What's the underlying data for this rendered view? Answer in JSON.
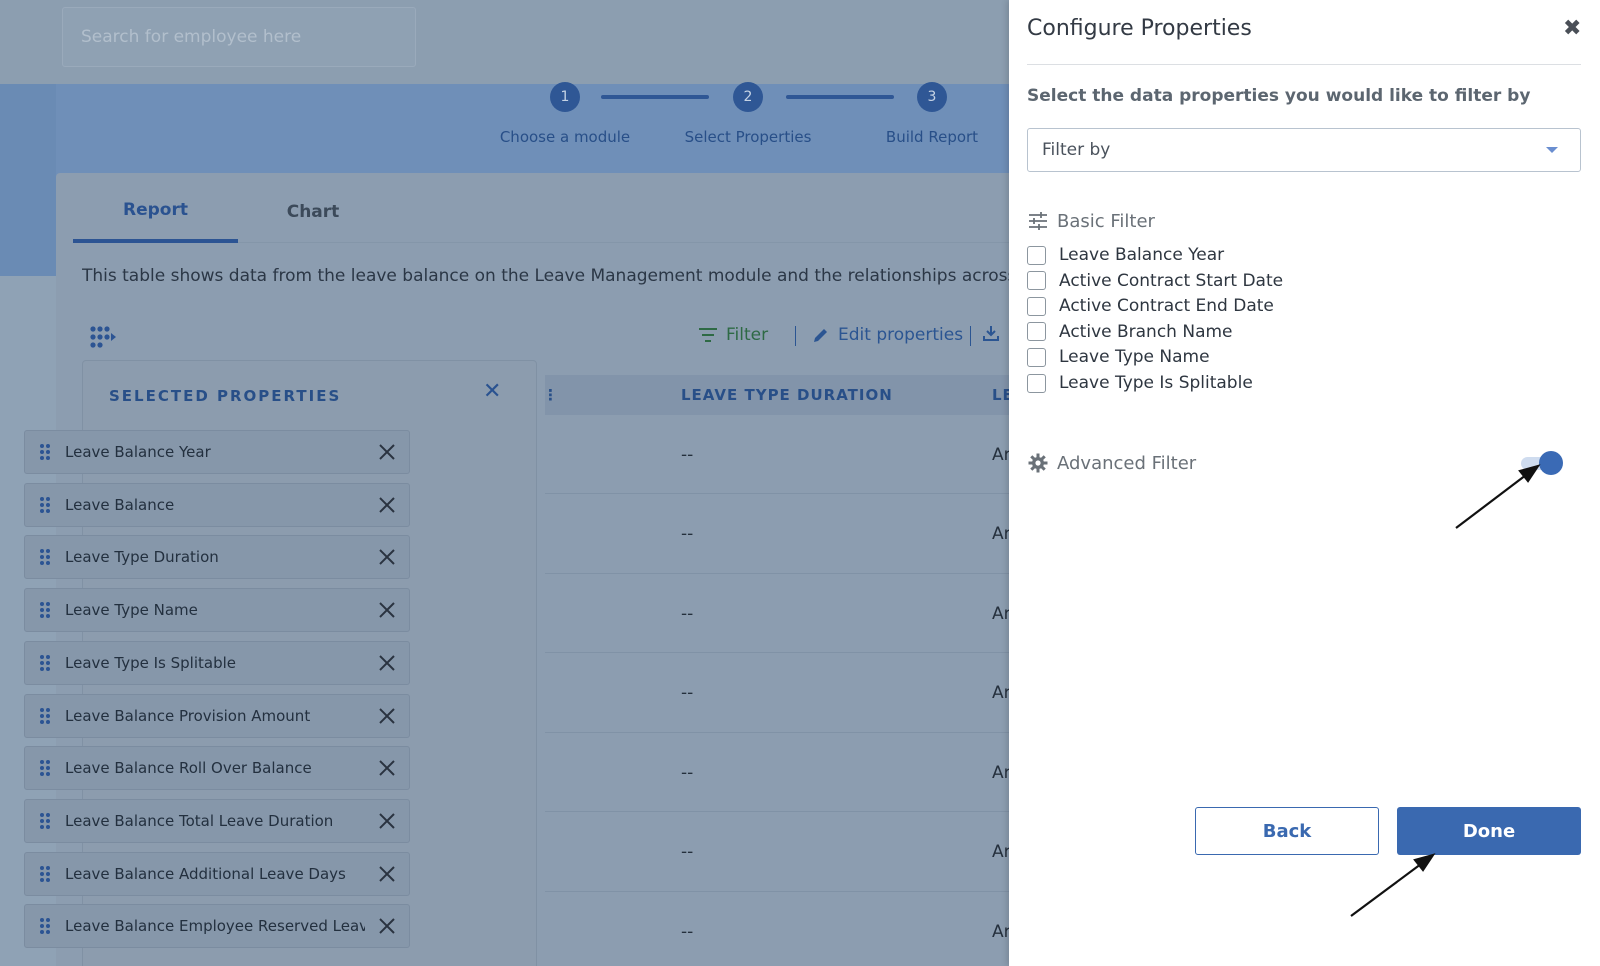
{
  "search": {
    "placeholder": "Search for employee here"
  },
  "stepper": {
    "steps": [
      {
        "number": "1",
        "label": "Choose a module"
      },
      {
        "number": "2",
        "label": "Select Properties"
      },
      {
        "number": "3",
        "label": "Build Report"
      }
    ]
  },
  "tabs": [
    {
      "label": "Report",
      "active": true
    },
    {
      "label": "Chart",
      "active": false
    }
  ],
  "description": "This table shows data from the leave balance on the Leave Management module and the relationships across oth",
  "toolbar": {
    "filter_label": "Filter",
    "edit_label": "Edit properties"
  },
  "selected_properties": {
    "title": "SELECTED PROPERTIES",
    "items": [
      "Leave Balance Year",
      "Leave Balance",
      "Leave Type Duration",
      "Leave Type Name",
      "Leave Type Is Splitable",
      "Leave Balance Provision Amount",
      "Leave Balance Roll Over Balance",
      "Leave Balance Total Leave Duration",
      "Leave Balance Additional Leave Days",
      "Leave Balance Employee Reserved Leave Da..."
    ]
  },
  "table": {
    "columns": [
      "LEAVE TYPE DURATION",
      "LE"
    ],
    "rows": [
      [
        "--",
        "Ar"
      ],
      [
        "--",
        "Ar"
      ],
      [
        "--",
        "Ar"
      ],
      [
        "--",
        "Ar"
      ],
      [
        "--",
        "Ar"
      ],
      [
        "--",
        "Ar"
      ],
      [
        "--",
        "Ar"
      ]
    ]
  },
  "modal": {
    "title": "Configure Properties",
    "subtitle": "Select the data properties you would like to filter by",
    "filter_select": {
      "value": "Filter by"
    },
    "basic_filter": {
      "label": "Basic Filter",
      "options": [
        "Leave Balance Year",
        "Active Contract Start Date",
        "Active Contract End Date",
        "Active Branch Name",
        "Leave Type Name",
        "Leave Type Is Splitable"
      ]
    },
    "advanced_filter": {
      "label": "Advanced Filter",
      "enabled": true
    },
    "buttons": {
      "back": "Back",
      "done": "Done"
    }
  },
  "colors": {
    "primary": "#3a69b0",
    "overlay": "#8fa2b5",
    "accent_green": "#2e6a45"
  }
}
